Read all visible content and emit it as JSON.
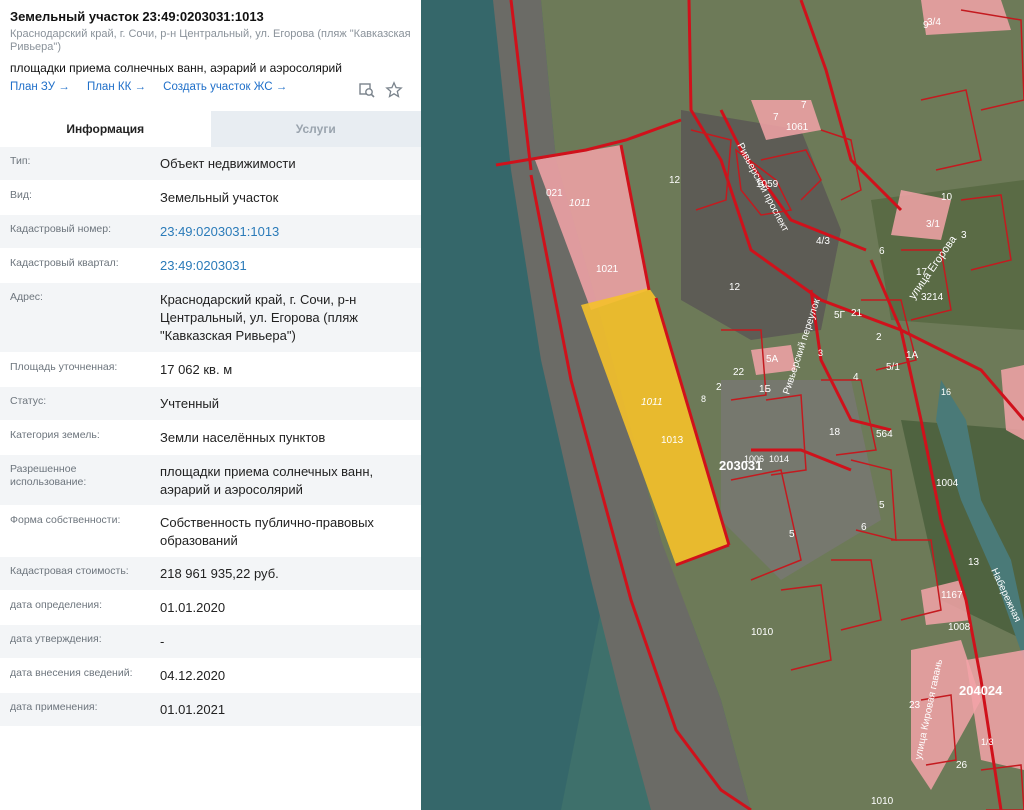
{
  "header": {
    "title": "Земельный участок 23:49:0203031:1013",
    "address_sub": "Краснодарский край, г. Сочи, р-н Центральный, ул. Егорова (пляж \"Кавказская Ривьера\")",
    "purpose": "площадки приема солнечных ванн, аэрарий и аэросолярий",
    "links": [
      "План ЗУ →",
      "План КК →",
      "Создать участок ЖС →"
    ],
    "icons": [
      "search-map-icon",
      "star-icon"
    ]
  },
  "tabs": [
    {
      "label": "Информация",
      "active": true
    },
    {
      "label": "Услуги",
      "active": false
    }
  ],
  "info_rows": [
    {
      "key": "Тип:",
      "value": "Объект недвижимости"
    },
    {
      "key": "Вид:",
      "value": "Земельный участок"
    },
    {
      "key": "Кадастровый номер:",
      "value": "23:49:0203031:1013",
      "link": true
    },
    {
      "key": "Кадастровый квартал:",
      "value": "23:49:0203031",
      "link": true
    },
    {
      "key": "Адрес:",
      "value": "Краснодарский край, г. Сочи, р-н Центральный, ул. Егорова (пляж \"Кавказская Ривьера\")"
    },
    {
      "key": "Площадь уточненная:",
      "value": "17 062 кв. м"
    },
    {
      "key": "Статус:",
      "value": "Учтенный"
    },
    {
      "key": "Категория земель:",
      "value": "Земли населённых пунктов"
    },
    {
      "key": "Разрешенное использование:",
      "value": "площадки приема солнечных ванн, аэрарий и аэросолярий"
    },
    {
      "key": "Форма собственности:",
      "value": "Собственность публично-правовых образований"
    },
    {
      "key": "Кадастровая стоимость:",
      "value": "218 961 935,22 руб."
    },
    {
      "key": "дата определения:",
      "value": "01.01.2020"
    },
    {
      "key": "дата утверждения:",
      "value": "-"
    },
    {
      "key": "дата внесения сведений:",
      "value": "04.12.2020"
    },
    {
      "key": "дата применения:",
      "value": "01.01.2021"
    }
  ],
  "map": {
    "quarter_labels": [
      "203031",
      "204024"
    ],
    "street_labels": [
      "улица Егорова",
      "Ривьерский переулок",
      "Ривьерский проспект",
      "улица Кировая гавань",
      "Набережная"
    ],
    "parcel_labels": [
      "1011",
      "1021",
      "021",
      "1013",
      "1011",
      "1059",
      "1061",
      "12",
      "12",
      "13",
      "7",
      "5",
      "3/4",
      "4/3",
      "1004",
      "1006",
      "1014",
      "5",
      "1010",
      "1167",
      "23",
      "26",
      "1010",
      "9",
      "5А",
      "1А",
      "3/1",
      "10",
      "3",
      "6",
      "18",
      "564",
      "16",
      "1008",
      "1/3",
      "5/1",
      "7",
      "2",
      "22",
      "1Б",
      "8",
      "3214",
      "4",
      "3",
      "5Г",
      "6",
      "2",
      "21",
      "17"
    ],
    "colors": {
      "water": "#3f6f6b",
      "land": "#6f7f5a",
      "parcel_border": "#d0111b",
      "parcel_fill": "#f3a3a8",
      "selected_fill": "#f5c12a"
    }
  }
}
